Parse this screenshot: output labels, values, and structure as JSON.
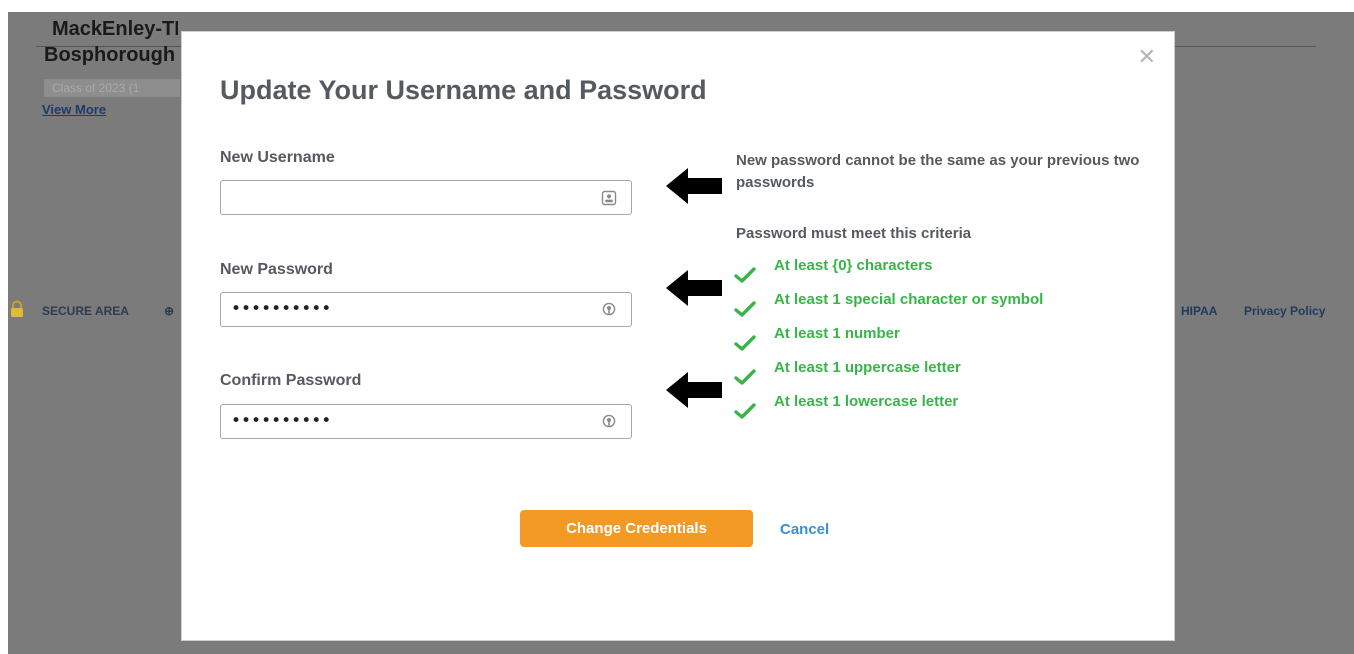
{
  "background": {
    "title_line1": "MackEnley-TEST (Mackenley-TEST)",
    "title_line2": "Bosphorough",
    "class_badge": "Class of 2023 (1",
    "view_more": "View More",
    "secure_area": "SECURE AREA",
    "hipaa": "HIPAA",
    "privacy_policy": "Privacy Policy"
  },
  "modal": {
    "title": "Update Your Username and Password",
    "close_icon": "close-icon",
    "fields": {
      "username": {
        "label": "New Username",
        "value": "",
        "icon": "contact-card-icon"
      },
      "password": {
        "label": "New Password",
        "masked_value": "••••••••••",
        "icon": "key-icon"
      },
      "confirm": {
        "label": "Confirm Password",
        "masked_value": "••••••••••",
        "icon": "key-icon"
      }
    },
    "hint": "New password cannot be the same as your previous two passwords",
    "criteria_heading": "Password must meet this criteria",
    "criteria": [
      {
        "label": "At least {0} characters",
        "met": true
      },
      {
        "label": "At least 1 special character or symbol",
        "met": true
      },
      {
        "label": "At least 1 number",
        "met": true
      },
      {
        "label": "At least 1 uppercase letter",
        "met": true
      },
      {
        "label": "At least 1 lowercase letter",
        "met": true
      }
    ],
    "buttons": {
      "submit": "Change Credentials",
      "cancel": "Cancel"
    }
  },
  "colors": {
    "overlay": "#7b7b7b",
    "accent_orange": "#f39a25",
    "success_green": "#38b549",
    "link_blue": "#3a8fd6",
    "heading_gray": "#555a60"
  }
}
